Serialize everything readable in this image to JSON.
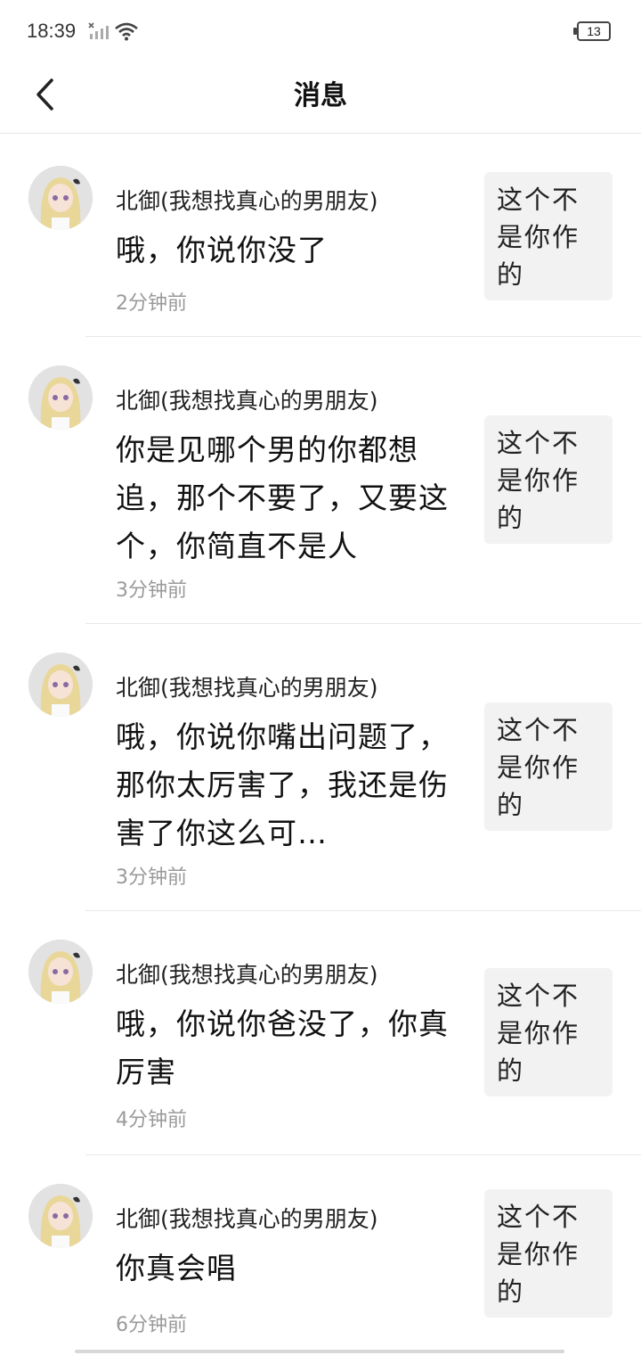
{
  "status_bar": {
    "time": "18:39",
    "battery": "13"
  },
  "header": {
    "title": "消息"
  },
  "messages": [
    {
      "sender": "北御(我想找真心的男朋友)",
      "text": "哦，你说你没了",
      "time": "2分钟前",
      "thumb_text": "这个不是你作的"
    },
    {
      "sender": "北御(我想找真心的男朋友)",
      "text": "你是见哪个男的你都想追，那个不要了，又要这个，你简直不是人",
      "time": "3分钟前",
      "thumb_text": "这个不是你作的"
    },
    {
      "sender": "北御(我想找真心的男朋友)",
      "text": "哦，你说你嘴出问题了，那你太厉害了，我还是伤害了你这么可…",
      "time": "3分钟前",
      "thumb_text": "这个不是你作的"
    },
    {
      "sender": "北御(我想找真心的男朋友)",
      "text": "哦，你说你爸没了，你真厉害",
      "time": "4分钟前",
      "thumb_text": "这个不是你作的"
    },
    {
      "sender": "北御(我想找真心的男朋友)",
      "text": "你真会唱",
      "time": "6分钟前",
      "thumb_text": "这个不是你作的"
    }
  ]
}
